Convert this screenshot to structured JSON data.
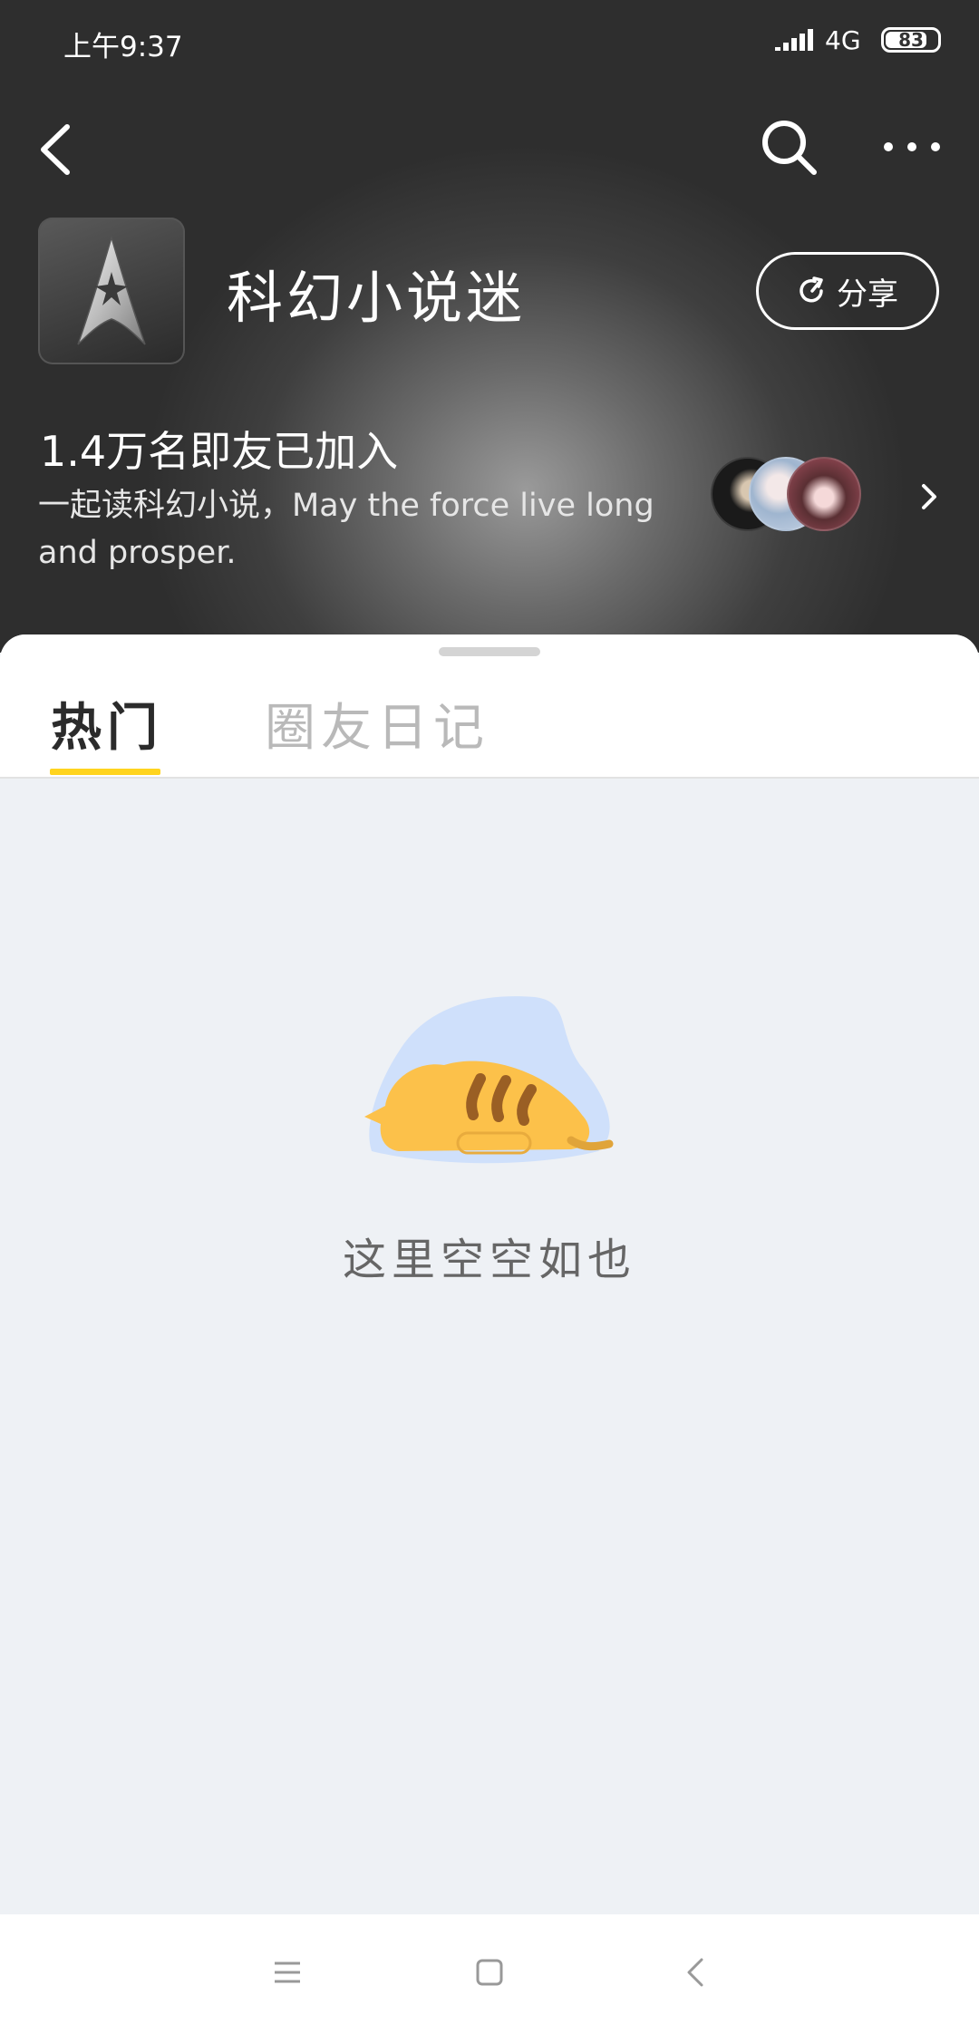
{
  "status_bar": {
    "time": "上午9:37",
    "network": "4G",
    "battery": "83"
  },
  "header": {
    "title": "科幻小说迷",
    "share_label": "分享",
    "member_count": "1.4万名即友已加入",
    "description": "一起读科幻小说，May the force live long and prosper."
  },
  "tabs": [
    {
      "label": "热门",
      "active": true
    },
    {
      "label": "圈友日记",
      "active": false
    }
  ],
  "empty_state": {
    "text": "这里空空如也"
  },
  "colors": {
    "accent": "#ffd41e",
    "header_bg": "#2e2e2e",
    "content_bg": "#eef1f5"
  },
  "icons": [
    "back-icon",
    "search-icon",
    "more-icon",
    "share-icon",
    "chevron-right-icon",
    "menu-icon",
    "home-icon",
    "nav-back-icon"
  ]
}
